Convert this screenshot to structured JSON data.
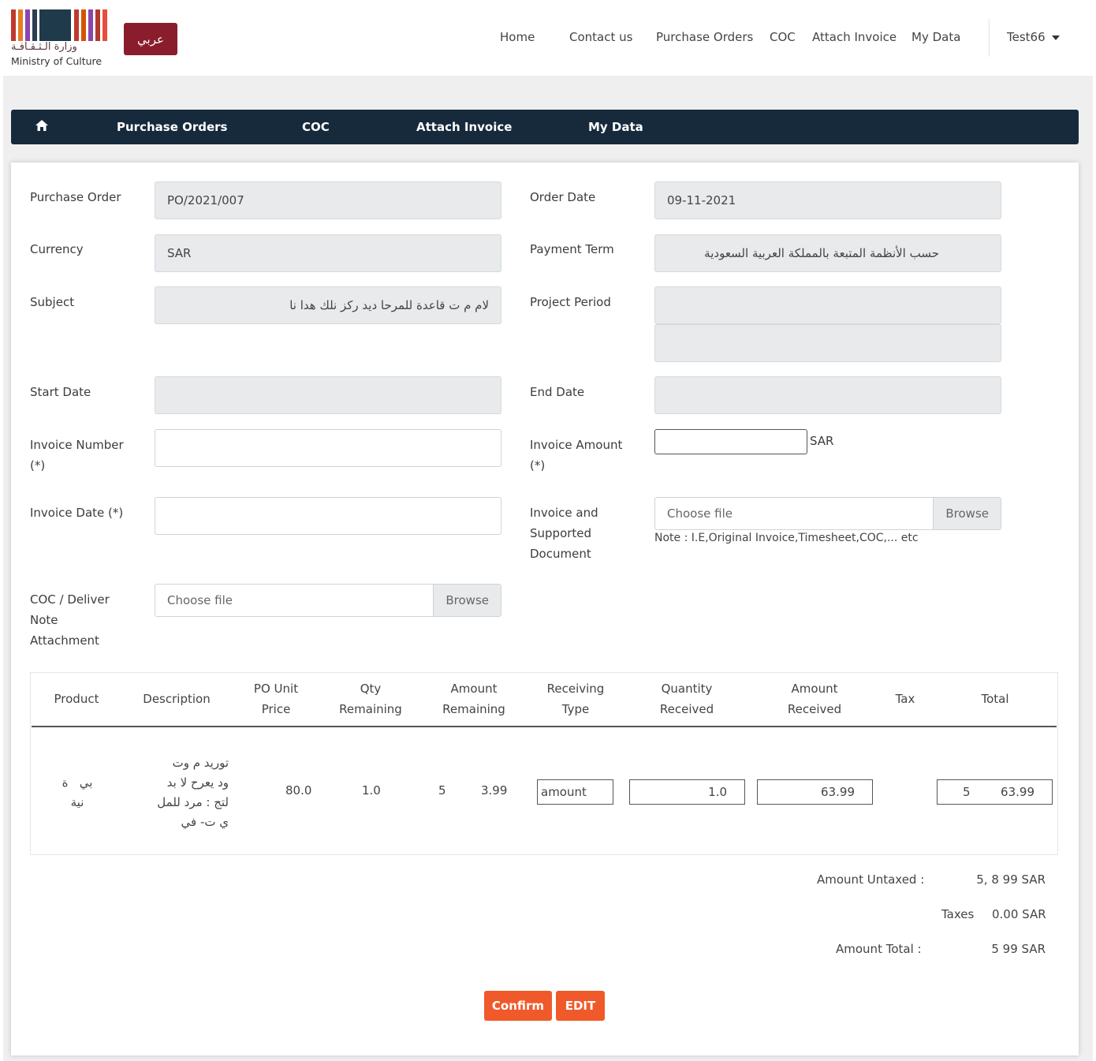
{
  "header": {
    "logo_ar": "وزارة الـثـقـافـة",
    "logo_en": "Ministry of Culture",
    "lang_button": "عربي",
    "nav": [
      "Home",
      "Contact us",
      "Purchase Orders",
      "COC",
      "Attach Invoice",
      "My Data"
    ],
    "user": "Test66"
  },
  "subnav": {
    "home_icon": "home-icon",
    "items": [
      "Purchase Orders",
      "COC",
      "Attach Invoice",
      "My Data"
    ]
  },
  "form": {
    "purchase_order_label": "Purchase Order",
    "purchase_order_value": "PO/2021/007",
    "order_date_label": "Order Date",
    "order_date_value": "09-11-2021",
    "currency_label": "Currency",
    "currency_value": "SAR",
    "payment_term_label": "Payment Term",
    "payment_term_value": "حسب الأنظمة المتبعة بالمملكة العربية السعودية",
    "subject_label": "Subject",
    "subject_value": "لام م ت قاعدة للمرحا ديد ركز نلك هدا نا",
    "project_period_label": "Project Period",
    "start_date_label": "Start Date",
    "end_date_label": "End Date",
    "invoice_number_label": "Invoice Number",
    "invoice_number_req": "(*)",
    "invoice_amount_label": "Invoice Amount",
    "invoice_amount_req": "(*)",
    "invoice_amount_unit": "SAR",
    "invoice_date_label": "Invoice Date (*)",
    "invoice_doc_label_1": "Invoice and",
    "invoice_doc_label_2": "Supported",
    "invoice_doc_label_3": "Document",
    "choose_file": "Choose file",
    "browse": "Browse",
    "note": "Note : I.E,Original Invoice,Timesheet,COC,... etc",
    "coc_label_1": "COC / Deliver",
    "coc_label_2": "Note",
    "coc_label_3": "Attachment"
  },
  "table": {
    "headers": [
      [
        "Product"
      ],
      [
        "Description"
      ],
      [
        "PO Unit",
        "Price"
      ],
      [
        "Qty",
        "Remaining"
      ],
      [
        "Amount",
        "Remaining"
      ],
      [
        "Receiving",
        "Type"
      ],
      [
        "Quantity",
        "Received"
      ],
      [
        "Amount",
        "Received"
      ],
      [
        "Tax"
      ],
      [
        "Total"
      ]
    ],
    "row": {
      "product": [
        "ة",
        "بي",
        "ة",
        "نية"
      ],
      "description": [
        "توريد م وت",
        "ود يعرح لا بد",
        "لتج : مرد للمل",
        "ي ت- في"
      ],
      "po_unit_price": "80.0",
      "qty_remaining": "1.0",
      "amount_remaining_a": "5",
      "amount_remaining_b": "3.99",
      "receiving_type": "amount",
      "quantity_received": "1.0",
      "amount_received": "63.99",
      "total_a": "5",
      "total_b": "63.99"
    }
  },
  "totals": {
    "untaxed_label": "Amount Untaxed :",
    "untaxed_value": "5, 8 99 SAR",
    "taxes_label": "Taxes",
    "taxes_value": "0.00 SAR",
    "total_label": "Amount Total :",
    "total_value": "5 99 SAR"
  },
  "buttons": {
    "confirm": "Confirm",
    "edit": "EDIT"
  },
  "colors": {
    "brand": "#8a1d2c",
    "navbar": "#162a3c",
    "action": "#f05a2a"
  }
}
